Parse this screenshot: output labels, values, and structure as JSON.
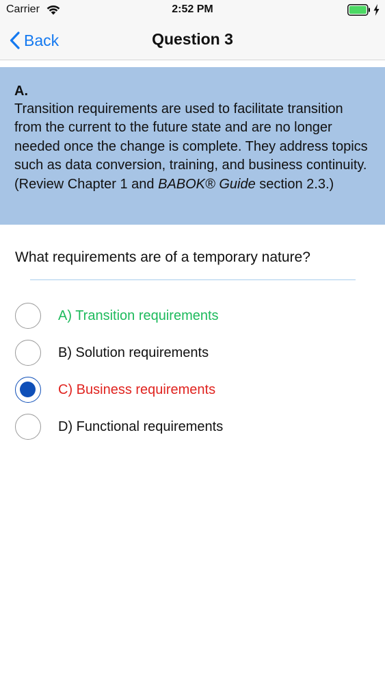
{
  "status_bar": {
    "carrier": "Carrier",
    "time": "2:52 PM",
    "icons": [
      "wifi-icon",
      "battery-icon",
      "charging-icon"
    ]
  },
  "nav": {
    "back_label": "Back",
    "title": "Question 3",
    "accent_color": "#1479f0"
  },
  "explanation": {
    "letter": "A.",
    "text_before": "Transition requirements are used to facilitate transition from the current to the future state and are no longer needed once the change is complete. They address topics such as data conversion, training, and business continuity. (Review Chapter 1 and ",
    "text_italic": "BABOK® Guide",
    "text_after": " section 2.3.)",
    "background_color": "#a7c4e5"
  },
  "question": {
    "text": "What requirements are of a temporary nature?"
  },
  "options": [
    {
      "label": "A) Transition requirements",
      "state": "correct",
      "selected": false
    },
    {
      "label": "B) Solution requirements",
      "state": "neutral",
      "selected": false
    },
    {
      "label": "C) Business requirements",
      "state": "wrong",
      "selected": true
    },
    {
      "label": "D) Functional requirements",
      "state": "neutral",
      "selected": false
    }
  ],
  "colors": {
    "correct": "#1dba5c",
    "wrong": "#e0231f",
    "selected_radio": "#0f4fb8"
  }
}
